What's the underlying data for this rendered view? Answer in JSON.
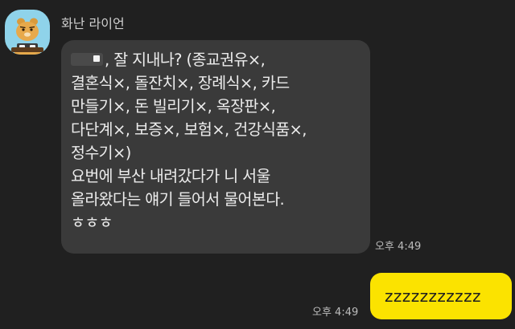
{
  "chat": {
    "sender": {
      "name": "화난 라이언",
      "avatar_icon": "ryan-lion-avatar-icon"
    },
    "incoming_message": {
      "first_line_suffix": ", 잘 지내나? (종교권유×,",
      "lines": [
        "결혼식×, 돌잔치×, 장례식×, 카드",
        "만들기×, 돈 빌리기×, 옥장판×,",
        "다단계×, 보증×, 보험×, 건강식품×,",
        "정수기×)",
        "요번에 부산 내려갔다가 니 서울",
        "올라왔다는 얘기 들어서 물어본다.",
        "ㅎㅎㅎ"
      ],
      "time": "오후 4:49"
    },
    "outgoing_message": {
      "text": "zzzzzzzzzzz",
      "time": "오후 4:49"
    },
    "colors": {
      "background": "#202020",
      "incoming_bubble": "#3a3a3a",
      "outgoing_bubble": "#fbe300",
      "avatar_background": "#8fd3ea"
    }
  }
}
